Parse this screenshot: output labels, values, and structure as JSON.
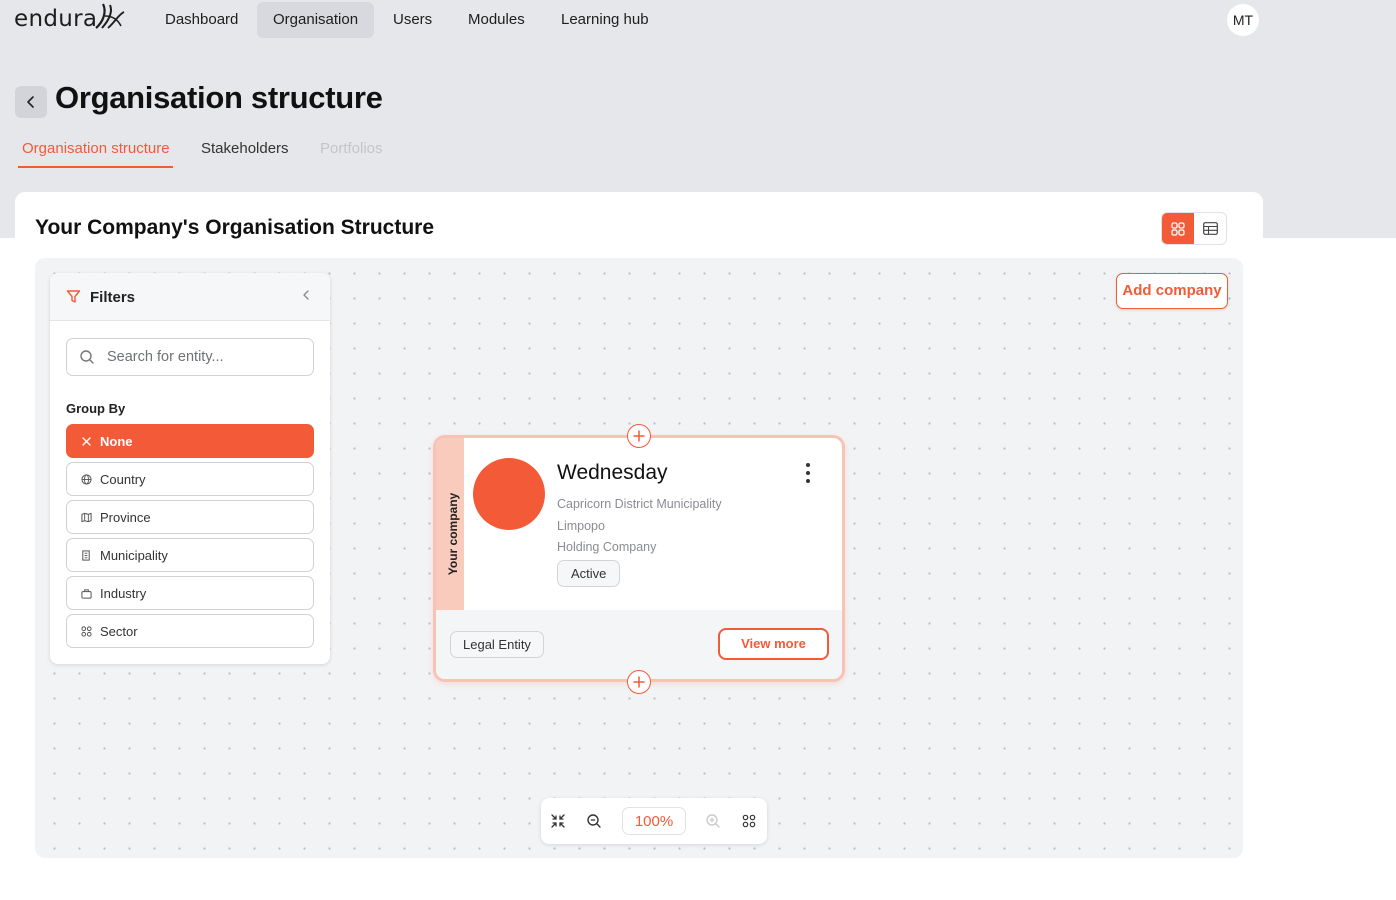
{
  "app": {
    "brand": "endura",
    "user_initials": "MT"
  },
  "nav": {
    "items": [
      {
        "label": "Dashboard"
      },
      {
        "label": "Organisation"
      },
      {
        "label": "Users"
      },
      {
        "label": "Modules"
      },
      {
        "label": "Learning hub"
      }
    ],
    "active": "Organisation"
  },
  "header": {
    "title": "Organisation structure",
    "tabs": [
      {
        "label": "Organisation structure",
        "state": "active"
      },
      {
        "label": "Stakeholders",
        "state": "normal"
      },
      {
        "label": "Portfolios",
        "state": "disabled"
      }
    ]
  },
  "main": {
    "title": "Your Company's Organisation Structure",
    "view_modes": [
      "grid",
      "table"
    ],
    "active_view": "grid",
    "add_company_label": "Add company"
  },
  "filters": {
    "title": "Filters",
    "search_placeholder": "Search for entity...",
    "group_by_label": "Group By",
    "options": [
      {
        "label": "None",
        "icon": "close-icon",
        "selected": true
      },
      {
        "label": "Country",
        "icon": "globe-icon",
        "selected": false
      },
      {
        "label": "Province",
        "icon": "map-icon",
        "selected": false
      },
      {
        "label": "Municipality",
        "icon": "building-icon",
        "selected": false
      },
      {
        "label": "Industry",
        "icon": "factory-icon",
        "selected": false
      },
      {
        "label": "Sector",
        "icon": "grid-icon",
        "selected": false
      }
    ]
  },
  "node": {
    "side_label": "Your company",
    "name": "Wednesday",
    "municipality": "Capricorn District Municipality",
    "province": "Limpopo",
    "company_type": "Holding Company",
    "status": "Active",
    "entity_type": "Legal Entity",
    "view_more_label": "View more"
  },
  "zoom": {
    "level": "100%"
  },
  "colors": {
    "accent": "#f25a38",
    "accent_light": "#f9cbbd",
    "band": "#e6e7ea"
  }
}
